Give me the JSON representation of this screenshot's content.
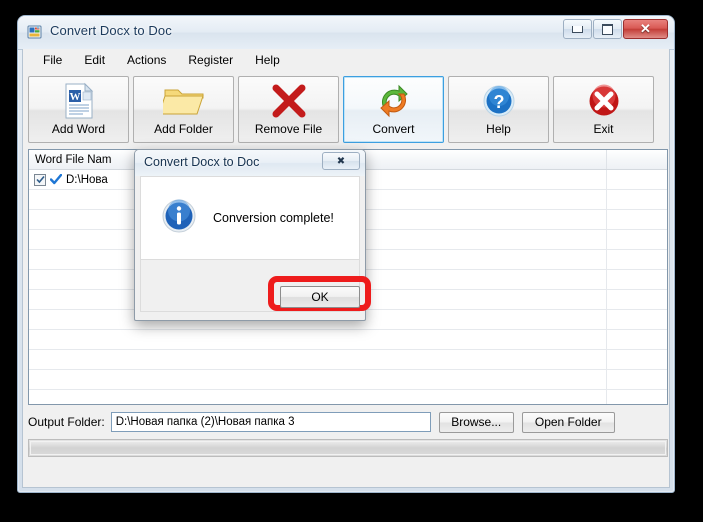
{
  "window": {
    "title": "Convert Docx to Doc",
    "icon": "app-convert-icon",
    "controls": {
      "minimize": "minimize-button",
      "maximize": "maximize-button",
      "close_glyph": "✕"
    }
  },
  "menubar": {
    "items": [
      {
        "label": "File"
      },
      {
        "label": "Edit"
      },
      {
        "label": "Actions"
      },
      {
        "label": "Register"
      },
      {
        "label": "Help"
      }
    ]
  },
  "toolbar": {
    "buttons": [
      {
        "label": "Add Word",
        "icon": "word-document-icon",
        "selected": false
      },
      {
        "label": "Add Folder",
        "icon": "folder-icon",
        "selected": false
      },
      {
        "label": "Remove File",
        "icon": "red-x-icon",
        "selected": false
      },
      {
        "label": "Convert",
        "icon": "convert-arrows-icon",
        "selected": true
      },
      {
        "label": "Help",
        "icon": "blue-question-icon",
        "selected": false
      },
      {
        "label": "Exit",
        "icon": "red-circle-x-icon",
        "selected": false
      }
    ]
  },
  "listview": {
    "columns": [
      {
        "label": "Word File Nam"
      },
      {
        "label": ""
      }
    ],
    "rows": [
      {
        "checked": true,
        "status": "converted-check",
        "path": "D:\\Нова"
      }
    ],
    "empty_row_count": 12
  },
  "output": {
    "label": "Output Folder:",
    "path": "D:\\Новая папка (2)\\Новая папка 3",
    "placeholder": "",
    "browse_label": "Browse...",
    "open_folder_label": "Open Folder"
  },
  "progress": {
    "value": 0
  },
  "dialog": {
    "title": "Convert Docx to Doc",
    "close_glyph": "✖",
    "icon": "info-icon",
    "message": "Conversion complete!",
    "ok_label": "OK"
  },
  "colors": {
    "accent_blue": "#3c9fe0",
    "highlight_ring": "#ee1c1c",
    "title_text": "#1b3a5c",
    "close_red": "#c33e38"
  }
}
